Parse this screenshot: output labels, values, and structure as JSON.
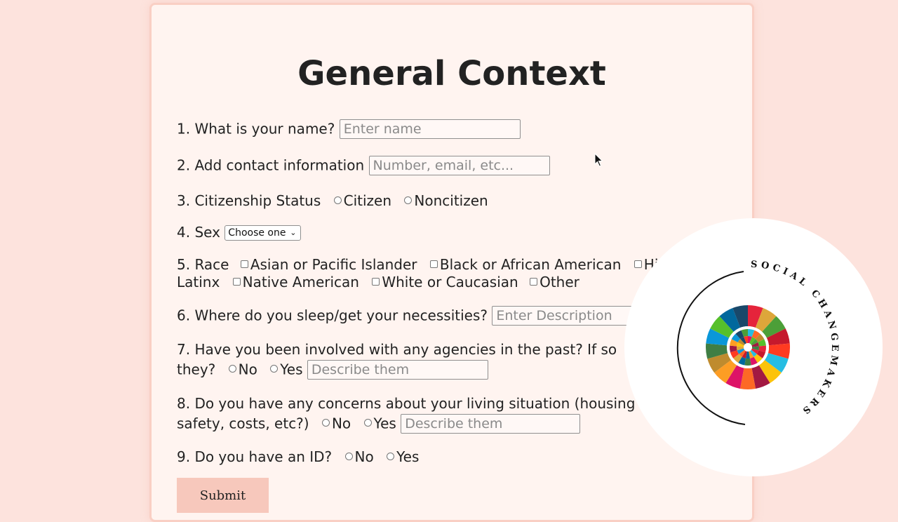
{
  "form": {
    "title": "General Context",
    "q1": {
      "label": "1. What is your name?",
      "placeholder": "Enter name"
    },
    "q2": {
      "label": "2. Add contact information",
      "placeholder": "Number, email, etc..."
    },
    "q3": {
      "label": "3. Citizenship Status",
      "options": [
        "Citizen",
        "Noncitizen"
      ]
    },
    "q4": {
      "label": "4. Sex",
      "select_value": "Choose one"
    },
    "q5": {
      "label": "5. Race",
      "options_line1": [
        "Asian or Pacific Islander",
        "Black or African American",
        "Hi"
      ],
      "line2_lead": "Latinx",
      "options_line2": [
        "Native American",
        "White or Caucasian",
        "Other"
      ]
    },
    "q6": {
      "label": "6. Where do you sleep/get your necessities?",
      "placeholder": "Enter Description"
    },
    "q7": {
      "line1": "7. Have you been involved with any agencies in the past? If so",
      "line2_lead": "they?",
      "options": [
        "No",
        "Yes"
      ],
      "placeholder": "Describe them"
    },
    "q8": {
      "line1": "8. Do you have any concerns about your living situation (housing",
      "line2_lead": "safety, costs, etc?)",
      "options": [
        "No",
        "Yes"
      ],
      "placeholder": "Describe them"
    },
    "q9": {
      "label": "9. Do you have an ID?",
      "options": [
        "No",
        "Yes"
      ]
    },
    "submit_label": "Submit"
  },
  "logo": {
    "text": "SOCIAL CHANGEMAKERS"
  },
  "colors": {
    "page_bg": "#fde3dd",
    "card_bg": "#fff4f0",
    "submit_bg": "#f7c8bc"
  }
}
